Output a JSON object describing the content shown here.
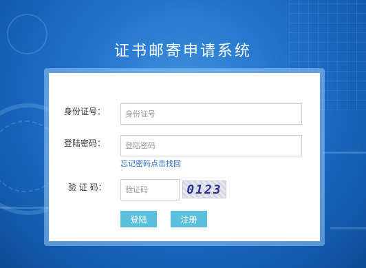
{
  "title": "证书邮寄申请系统",
  "form": {
    "id_label": "身份证号：",
    "id_placeholder": "身份证号",
    "password_label": "登陆密码：",
    "password_placeholder": "登陆密码",
    "forgot_link": "忘记密码点击找回",
    "captcha_label": "验 证 码：",
    "captcha_placeholder": "验证码",
    "captcha_text": "0123",
    "login_button": "登陆",
    "register_button": "注册"
  },
  "colors": {
    "background": "#1f6fc9",
    "button": "#5bc0de",
    "link": "#2a6fc9"
  }
}
